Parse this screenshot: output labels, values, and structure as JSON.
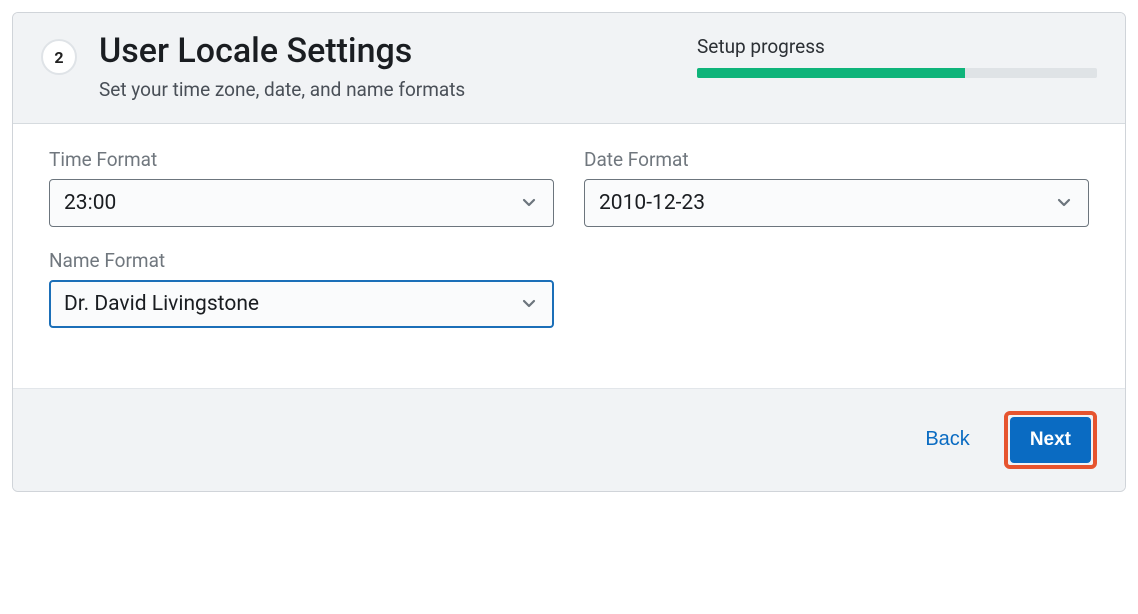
{
  "step": {
    "number": "2",
    "title": "User Locale Settings",
    "subtitle": "Set your time zone, date, and name formats"
  },
  "progress": {
    "label": "Setup progress",
    "percent": 67
  },
  "fields": {
    "time_format": {
      "label": "Time Format",
      "value": "23:00"
    },
    "date_format": {
      "label": "Date Format",
      "value": "2010-12-23"
    },
    "name_format": {
      "label": "Name Format",
      "value": "Dr. David Livingstone"
    }
  },
  "footer": {
    "back": "Back",
    "next": "Next"
  }
}
